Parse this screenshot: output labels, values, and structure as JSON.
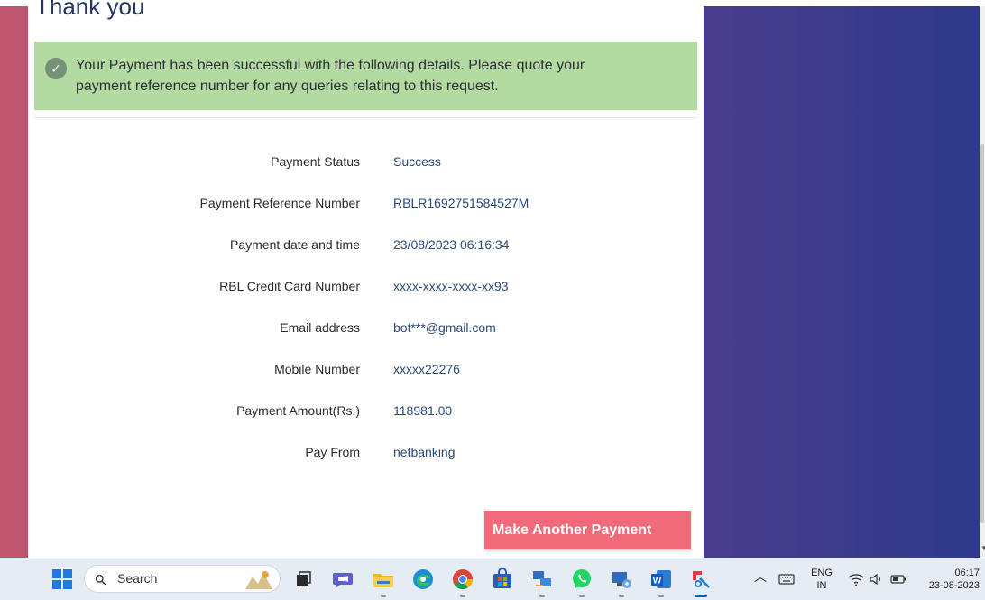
{
  "page": {
    "title": "Thank you",
    "alert_text": "Your Payment has been successful with the following details. Please quote your payment reference number for any queries relating to this request.",
    "details": [
      {
        "label": "Payment Status",
        "value": "Success"
      },
      {
        "label": "Payment Reference Number",
        "value": "RBLR1692751584527M"
      },
      {
        "label": "Payment date and time",
        "value": "23/08/2023 06:16:34"
      },
      {
        "label": "RBL Credit Card Number",
        "value": "xxxx-xxxx-xxxx-xx93"
      },
      {
        "label": "Email address",
        "value": "bot***@gmail.com"
      },
      {
        "label": "Mobile Number",
        "value": "xxxxx22276"
      },
      {
        "label": "Payment Amount(Rs.)",
        "value": "118981.00"
      },
      {
        "label": "Pay From",
        "value": "netbanking"
      }
    ],
    "button_label": "Make Another Payment"
  },
  "taskbar": {
    "search_placeholder": "Search",
    "apps": [
      "start-icon",
      "task-view-icon",
      "meet-icon",
      "file-explorer-icon",
      "edge-icon",
      "chrome-icon",
      "store-icon",
      "network-app-icon",
      "whatsapp-icon",
      "remote-desktop-icon",
      "word-icon",
      "snipping-tool-icon"
    ],
    "lang_top": "ENG",
    "lang_bottom": "IN",
    "time": "06:17",
    "date": "23-08-2023"
  },
  "colors": {
    "success_bg": "#b3daa0",
    "button_bg": "#f06a79",
    "value_text": "#2a4a7a"
  }
}
